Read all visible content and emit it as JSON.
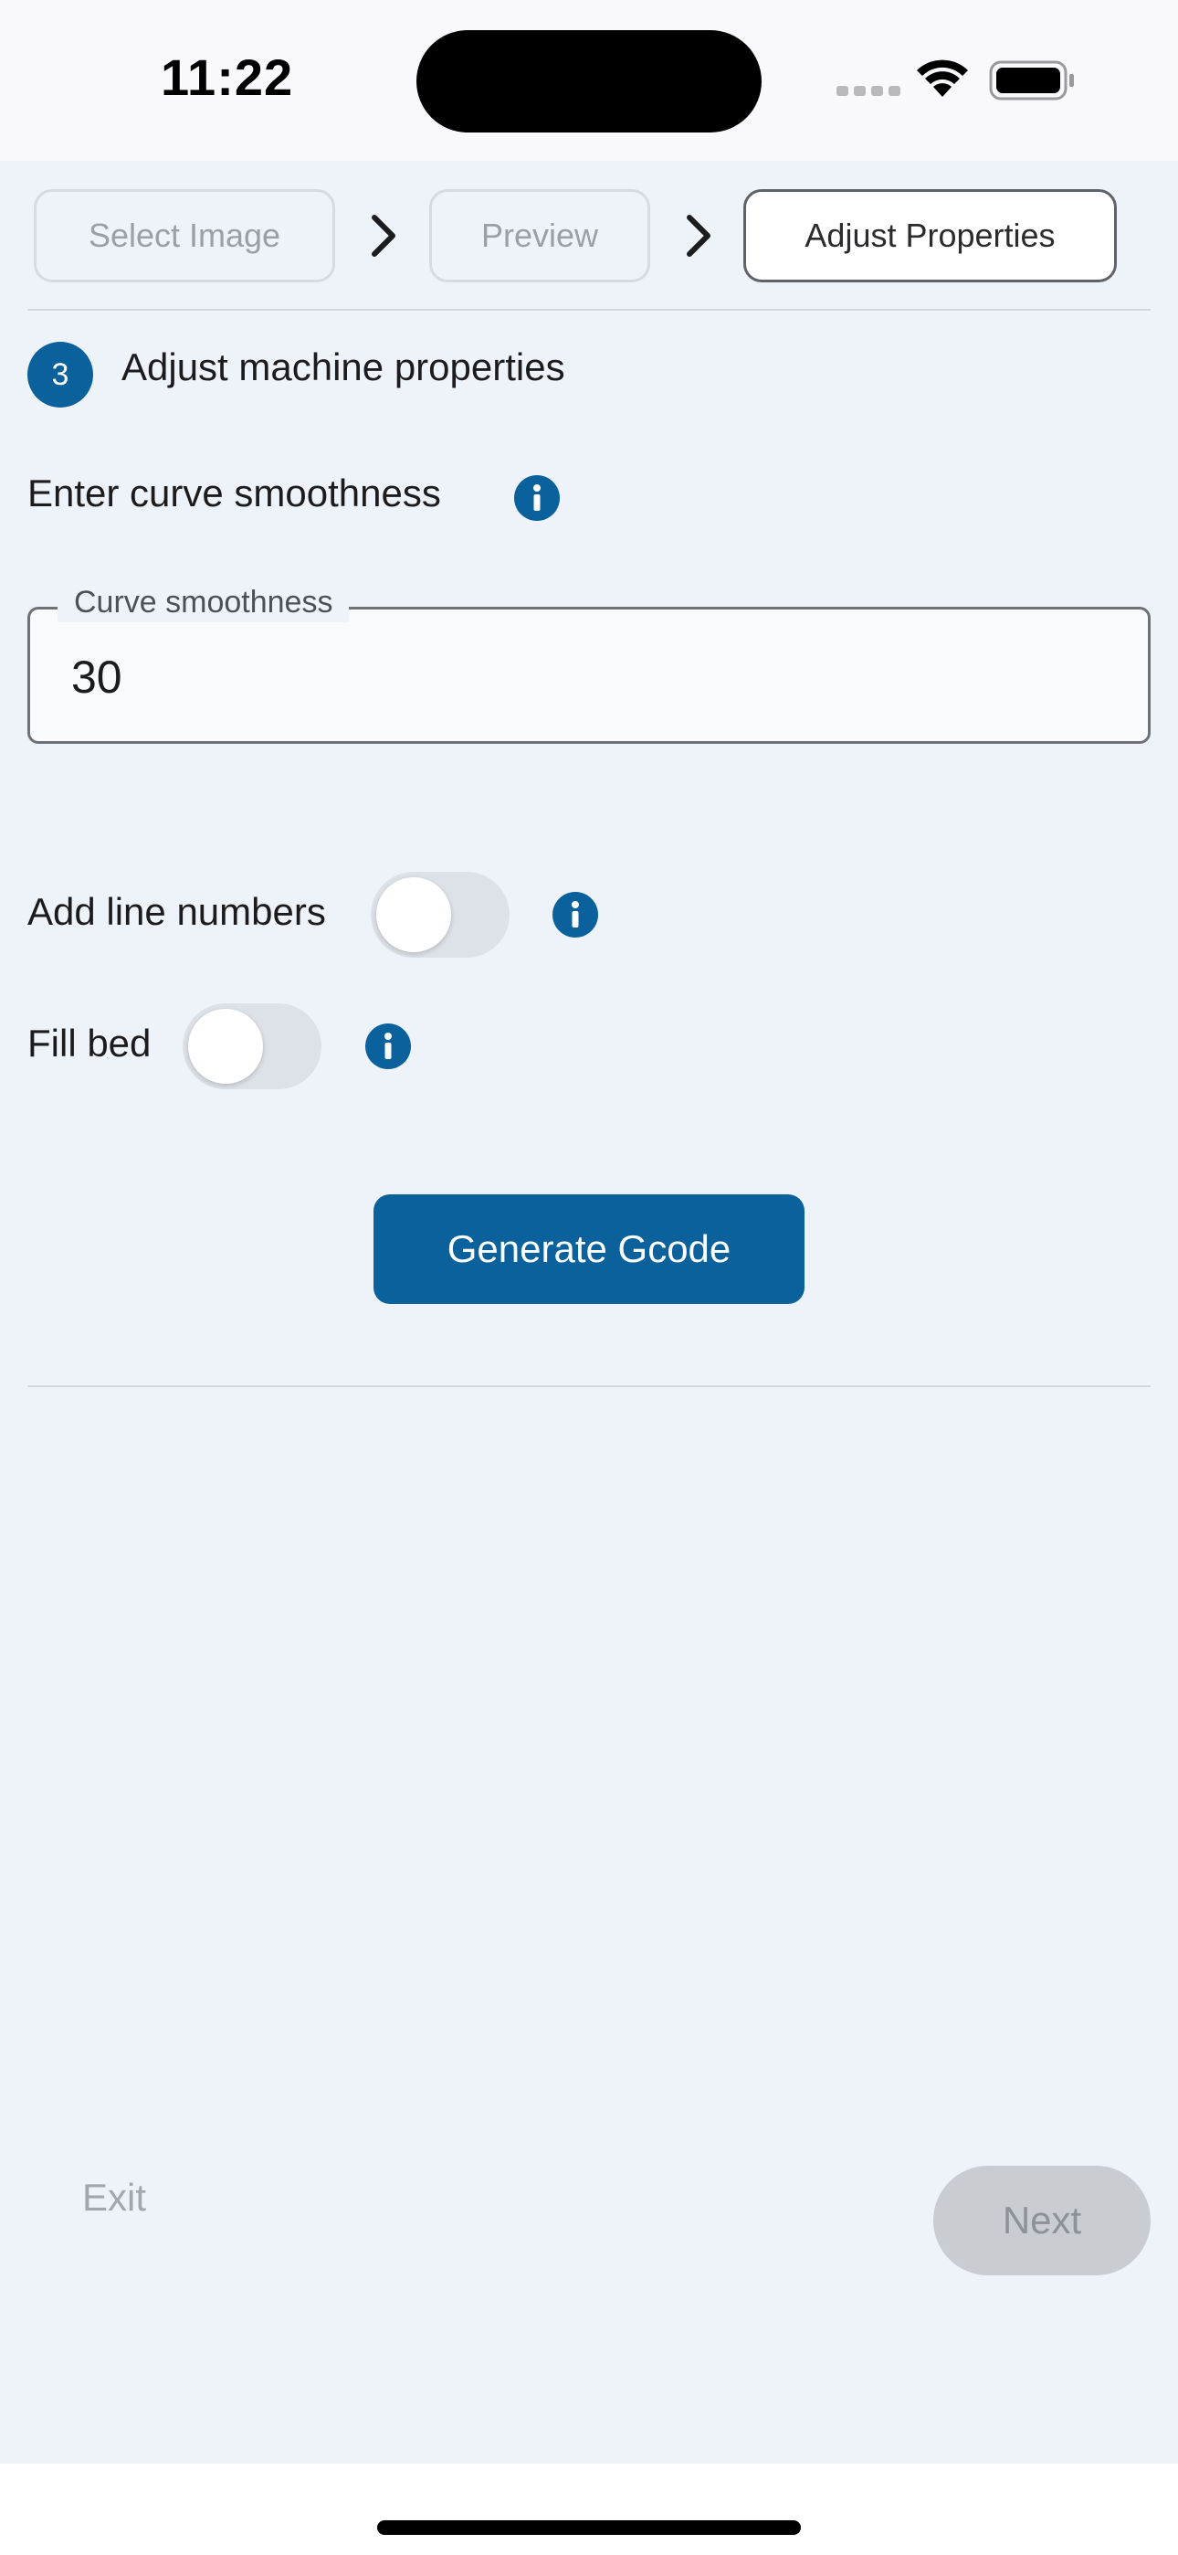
{
  "status_bar": {
    "time": "11:22"
  },
  "stepper": {
    "steps": [
      {
        "label": "Select Image",
        "state": "inactive"
      },
      {
        "label": "Preview",
        "state": "inactive"
      },
      {
        "label": "Adjust Properties",
        "state": "active"
      }
    ]
  },
  "section": {
    "step_number": "3",
    "title": "Adjust machine properties"
  },
  "curve": {
    "label": "Enter curve smoothness",
    "field_legend": "Curve smoothness",
    "field_value": "30"
  },
  "toggles": {
    "line_numbers": {
      "label": "Add line numbers",
      "on": false
    },
    "fill_bed": {
      "label": "Fill bed",
      "on": false
    }
  },
  "actions": {
    "generate_label": "Generate Gcode",
    "exit_label": "Exit",
    "next_label": "Next"
  },
  "colors": {
    "accent": "#0a619b",
    "background": "#eef3fa",
    "disabled_button": "#c9cdd2"
  },
  "icons": {
    "info": "info-icon",
    "chevron": "chevron-right-icon",
    "wifi": "wifi-icon",
    "battery": "battery-icon"
  }
}
